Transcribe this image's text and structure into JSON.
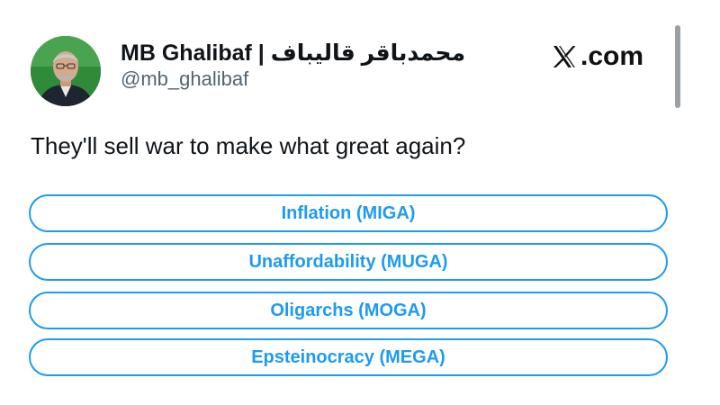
{
  "author": {
    "display_name": "MB Ghalibaf | محمدباقر قالیباف",
    "handle": "@mb_ghalibaf",
    "avatar_icon": "profile-photo"
  },
  "brand": {
    "label": ".com",
    "logo_icon": "x-logo-icon"
  },
  "post": {
    "text": "They'll sell war to make what great again?"
  },
  "poll": {
    "accent_color": "#1d9bf0",
    "options": [
      {
        "label": "Inflation (MIGA)"
      },
      {
        "label": "Unaffordability (MUGA)"
      },
      {
        "label": "Oligarchs (MOGA)"
      },
      {
        "label": "Epsteinocracy (MEGA)"
      }
    ]
  }
}
